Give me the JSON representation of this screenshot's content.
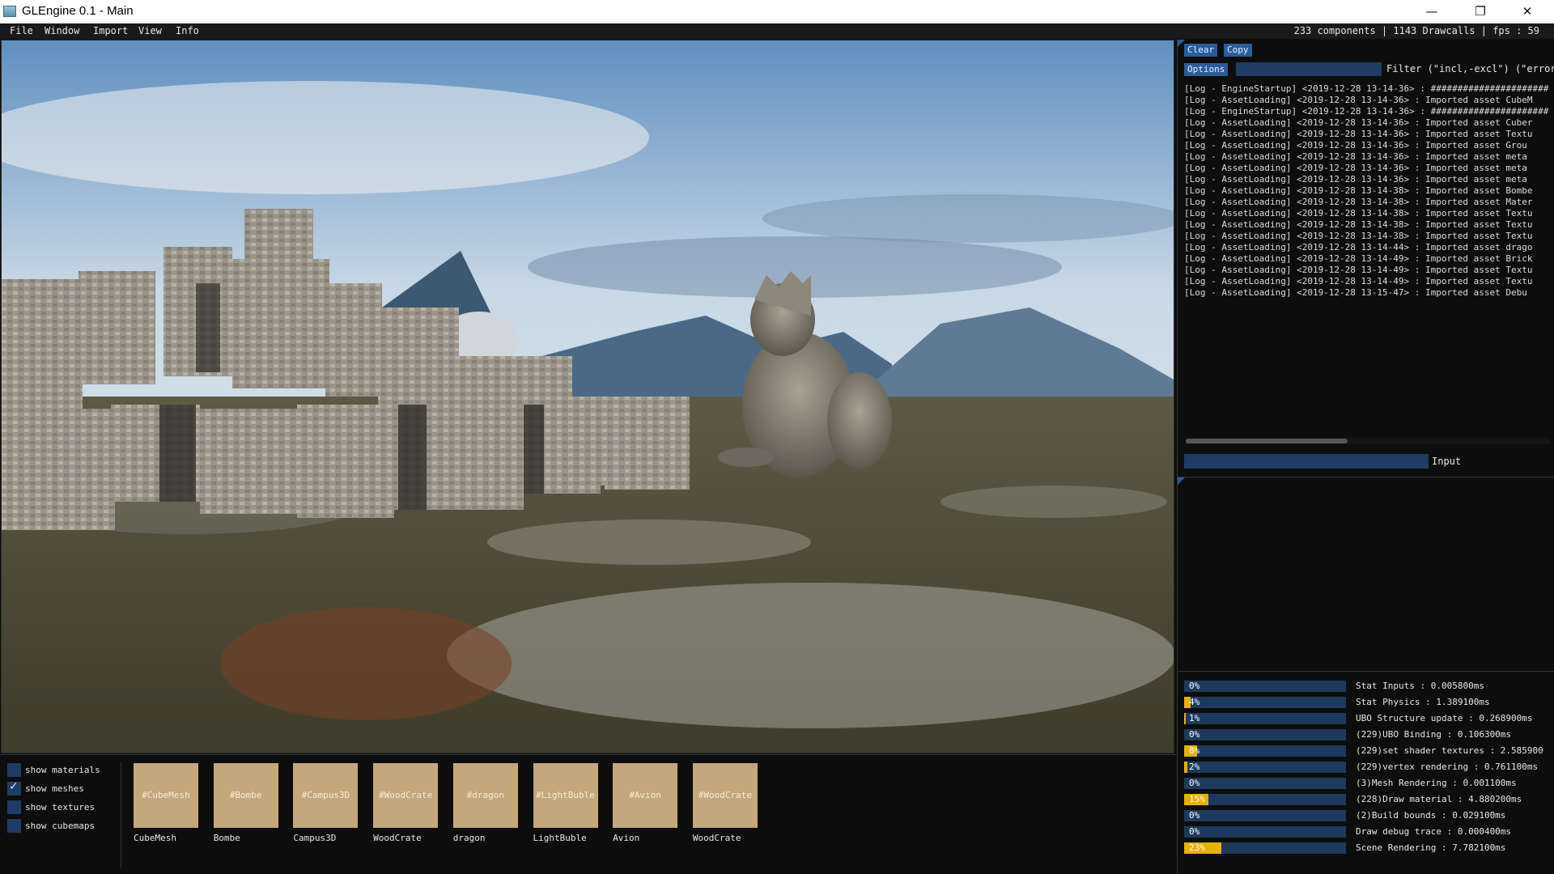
{
  "window": {
    "title": "GLEngine 0.1 - Main",
    "minimize": "—",
    "restore": "❐",
    "close": "✕"
  },
  "menu": {
    "items": [
      "File",
      "Window",
      "Import",
      "View",
      "Info"
    ],
    "stats": "233 components | 1143 Drawcalls | fps : 59"
  },
  "console": {
    "clear_label": "Clear",
    "copy_label": "Copy",
    "options_label": "Options",
    "filter_label": "Filter (\"incl,-excl\") (\"error",
    "input_label": "Input",
    "log": [
      "[Log - EngineStartup] <2019-12-28 13-14-36> : ######################",
      "[Log - AssetLoading] <2019-12-28 13-14-36> : Imported asset CubeM",
      "[Log - EngineStartup] <2019-12-28 13-14-36> : ######################",
      "[Log - AssetLoading] <2019-12-28 13-14-36> : Imported asset Cuber",
      "[Log - AssetLoading] <2019-12-28 13-14-36> : Imported asset Textu",
      "[Log - AssetLoading] <2019-12-28 13-14-36> : Imported asset Grou",
      "[Log - AssetLoading] <2019-12-28 13-14-36> : Imported asset meta",
      "[Log - AssetLoading] <2019-12-28 13-14-36> : Imported asset meta",
      "[Log - AssetLoading] <2019-12-28 13-14-36> : Imported asset meta",
      "[Log - AssetLoading] <2019-12-28 13-14-38> : Imported asset Bombe",
      "[Log - AssetLoading] <2019-12-28 13-14-38> : Imported asset Mater",
      "[Log - AssetLoading] <2019-12-28 13-14-38> : Imported asset Textu",
      "[Log - AssetLoading] <2019-12-28 13-14-38> : Imported asset Textu",
      "[Log - AssetLoading] <2019-12-28 13-14-38> : Imported asset Textu",
      "[Log - AssetLoading] <2019-12-28 13-14-44> : Imported asset drago",
      "[Log - AssetLoading] <2019-12-28 13-14-49> : Imported asset Brick",
      "[Log - AssetLoading] <2019-12-28 13-14-49> : Imported asset Textu",
      "[Log - AssetLoading] <2019-12-28 13-14-49> : Imported asset Textu",
      "[Log - AssetLoading] <2019-12-28 13-15-47> : Imported asset Debu"
    ]
  },
  "profiler": [
    {
      "pct": "0%",
      "value": 0,
      "label": "Stat Inputs : 0.005800ms"
    },
    {
      "pct": "4%",
      "value": 0.04,
      "label": "Stat Physics : 1.389100ms"
    },
    {
      "pct": "1%",
      "value": 0.01,
      "label": "UBO Structure update : 0.268900ms"
    },
    {
      "pct": "0%",
      "value": 0,
      "label": "(229)UBO Binding : 0.106300ms"
    },
    {
      "pct": "8%",
      "value": 0.08,
      "label": "(229)set shader textures : 2.585900"
    },
    {
      "pct": "2%",
      "value": 0.02,
      "label": "(229)vertex rendering : 0.761100ms"
    },
    {
      "pct": "0%",
      "value": 0,
      "label": "(3)Mesh Rendering : 0.001100ms"
    },
    {
      "pct": "15%",
      "value": 0.15,
      "label": "(228)Draw material : 4.880200ms"
    },
    {
      "pct": "0%",
      "value": 0,
      "label": "(2)Build bounds : 0.029100ms"
    },
    {
      "pct": "0%",
      "value": 0,
      "label": "Draw debug trace : 0.000400ms"
    },
    {
      "pct": "23%",
      "value": 0.23,
      "label": "Scene Rendering : 7.782100ms"
    }
  ],
  "assets": {
    "toggles": [
      {
        "label": "show materials",
        "checked": false
      },
      {
        "label": "show meshes",
        "checked": true
      },
      {
        "label": "show textures",
        "checked": false
      },
      {
        "label": "show cubemaps",
        "checked": false
      }
    ],
    "items": [
      {
        "thumb": "#CubeMesh",
        "name": "CubeMesh"
      },
      {
        "thumb": "#Bombe",
        "name": "Bombe"
      },
      {
        "thumb": "#Campus3D",
        "name": "Campus3D"
      },
      {
        "thumb": "#WoodCrate",
        "name": "WoodCrate"
      },
      {
        "thumb": "#dragon",
        "name": "dragon"
      },
      {
        "thumb": "#LightBuble",
        "name": "LightBuble"
      },
      {
        "thumb": "#Avion",
        "name": "Avion"
      },
      {
        "thumb": "#WoodCrate",
        "name": "WoodCrate"
      }
    ]
  }
}
